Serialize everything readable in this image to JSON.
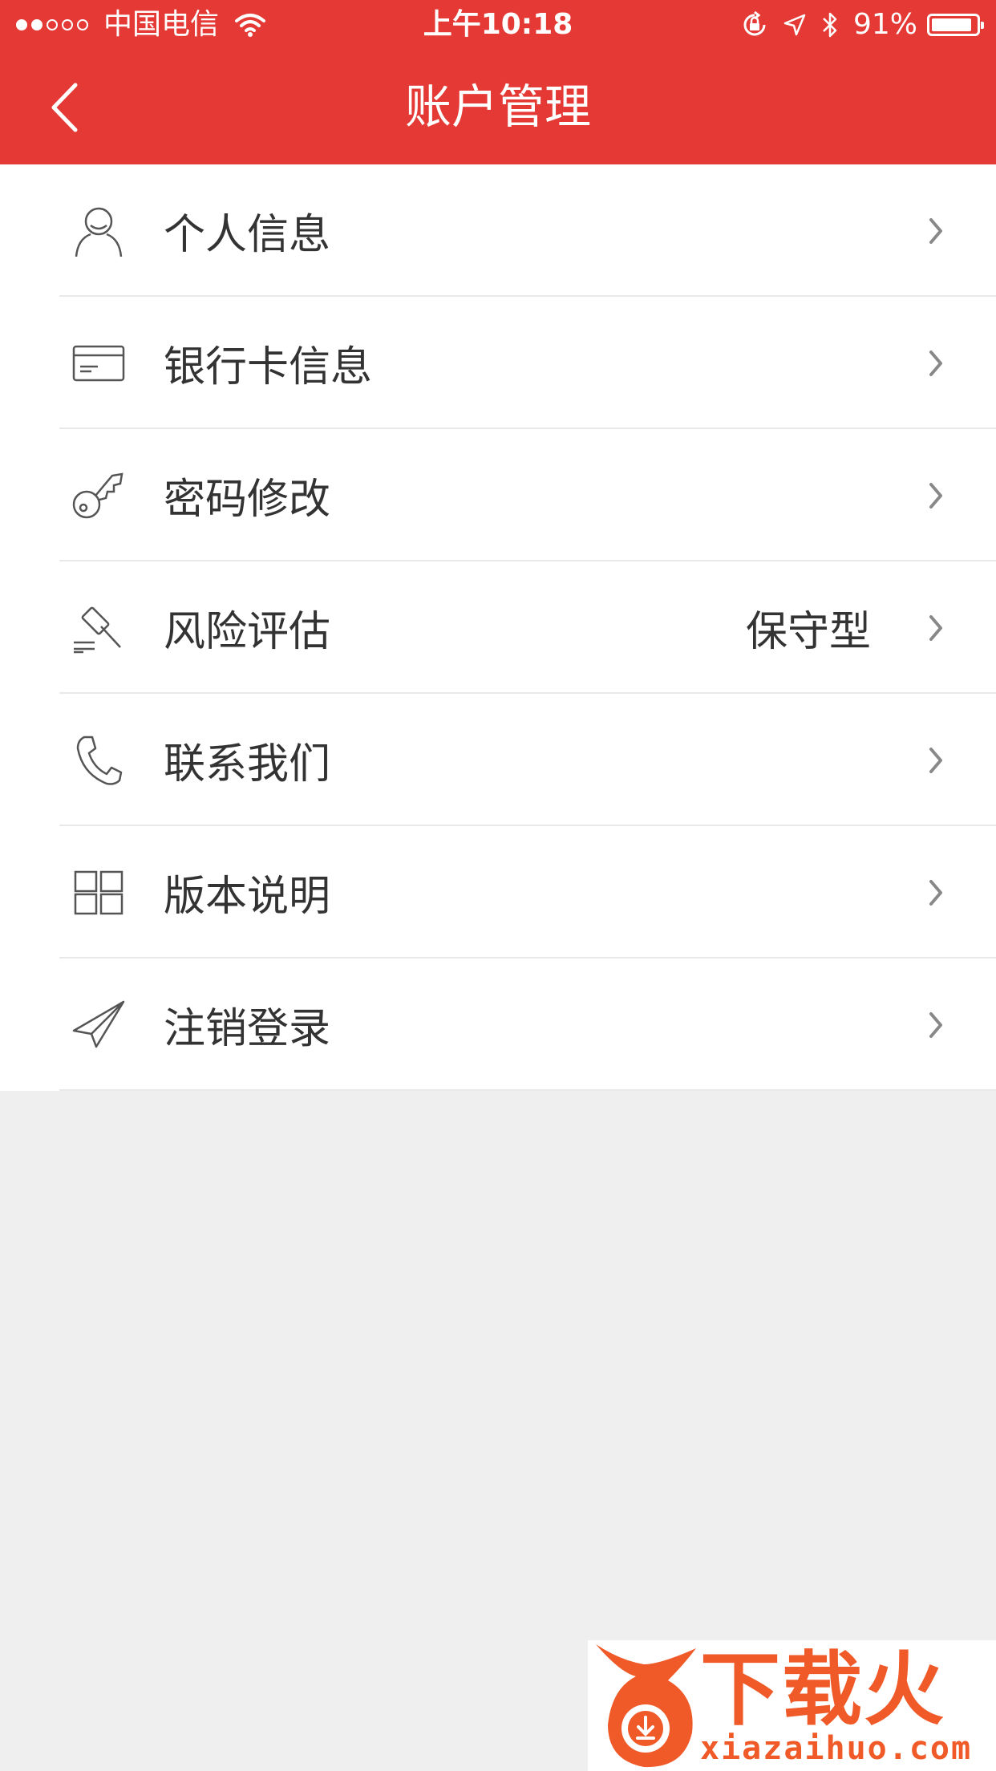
{
  "status_bar": {
    "carrier": "中国电信",
    "time": "上午10:18",
    "battery": "91%",
    "battery_level": 0.91,
    "signal_strength": 2,
    "signal_max": 5
  },
  "nav": {
    "title": "账户管理",
    "back_icon": "chevron-left-icon"
  },
  "menu": {
    "items": [
      {
        "label": "个人信息",
        "value": "",
        "icon": "person-icon"
      },
      {
        "label": "银行卡信息",
        "value": "",
        "icon": "card-icon"
      },
      {
        "label": "密码修改",
        "value": "",
        "icon": "key-icon"
      },
      {
        "label": "风险评估",
        "value": "保守型",
        "icon": "gavel-icon"
      },
      {
        "label": "联系我们",
        "value": "",
        "icon": "phone-icon"
      },
      {
        "label": "版本说明",
        "value": "",
        "icon": "grid-icon"
      },
      {
        "label": "注销登录",
        "value": "",
        "icon": "paper-plane-icon"
      }
    ]
  },
  "watermark": {
    "brand": "下载火",
    "url": "xiazaihuo.com"
  },
  "colors": {
    "header": "#e53935",
    "background": "#efefef",
    "text": "#333333",
    "icon": "#555555",
    "chevron": "#888888",
    "watermark": "#f05a28"
  }
}
